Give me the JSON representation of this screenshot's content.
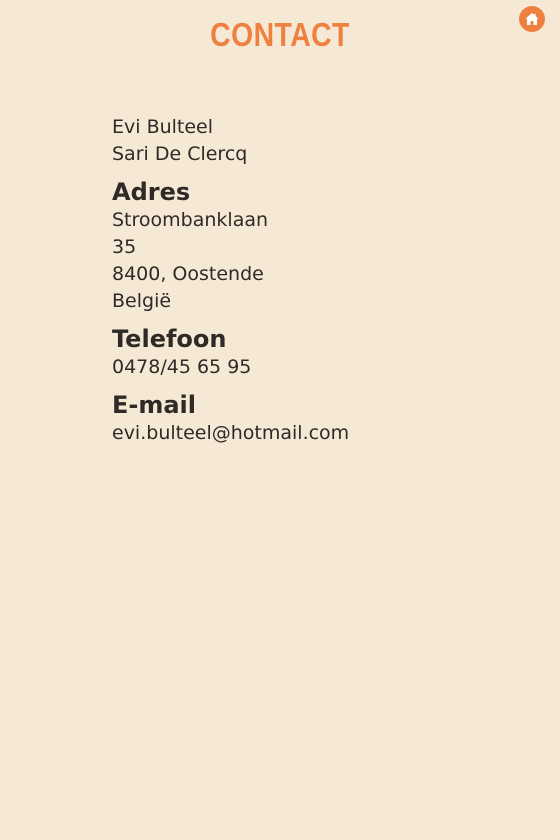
{
  "header": {
    "title": "CONTACT",
    "home_icon": "home-icon",
    "accent_color": "#ee8040",
    "background_color": "#f5e9d6"
  },
  "contact": {
    "names": [
      "Evi Bulteel",
      "Sari De Clercq"
    ],
    "address": {
      "heading": "Adres",
      "street": "Stroombanklaan",
      "number": "35",
      "city": "8400, Oostende",
      "country": "België"
    },
    "phone": {
      "heading": "Telefoon",
      "value": "0478/45 65 95"
    },
    "email": {
      "heading": "E-mail",
      "value": "evi.bulteel@hotmail.com"
    }
  }
}
